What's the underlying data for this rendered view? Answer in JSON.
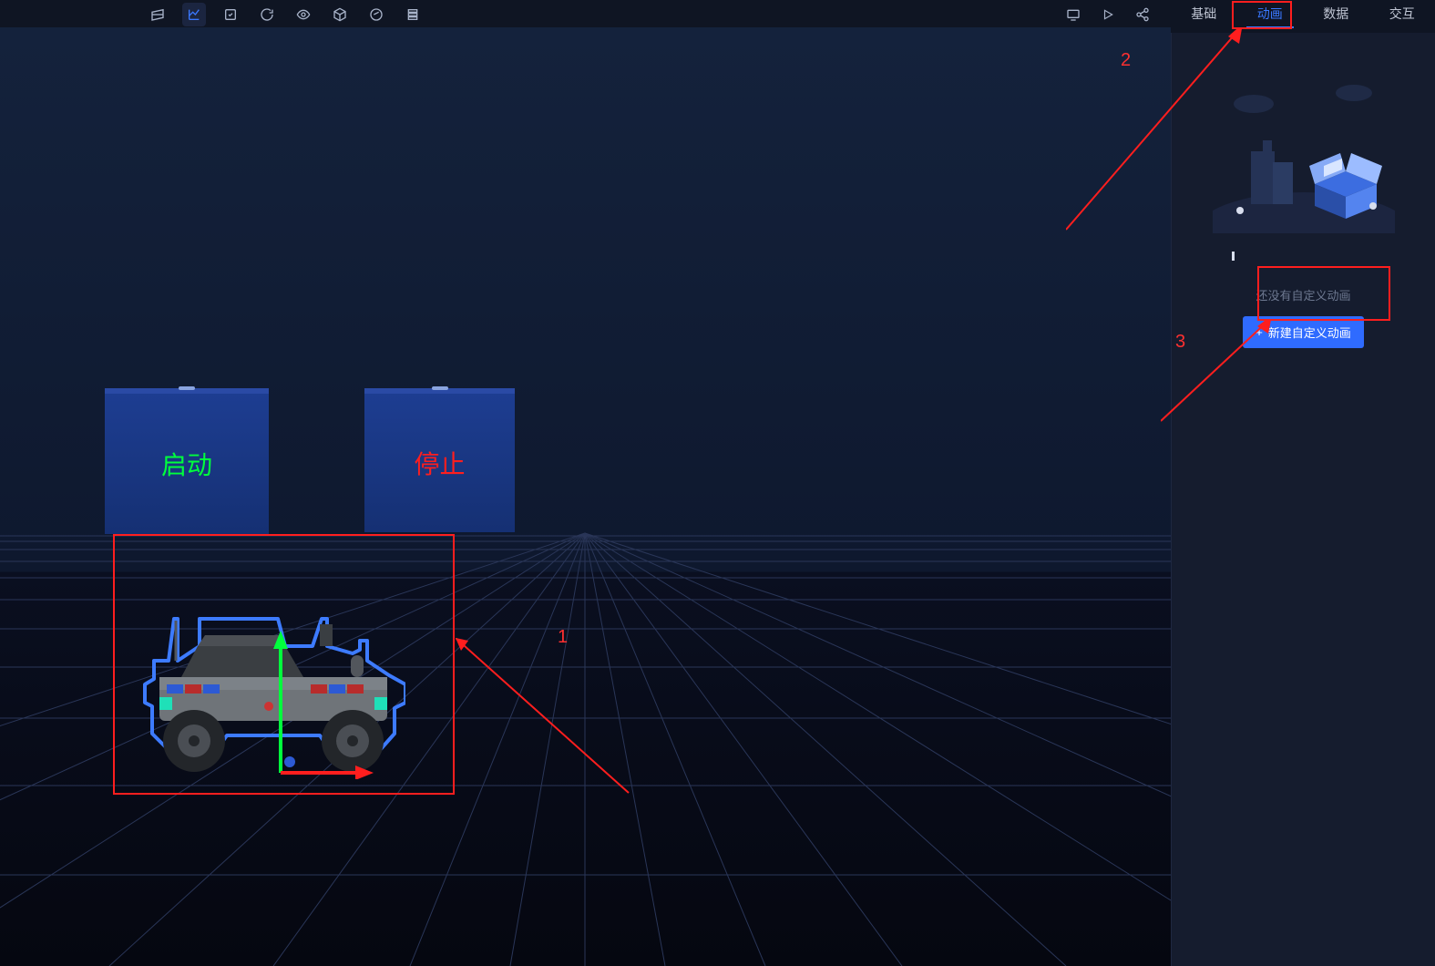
{
  "toolbarLeftIcons": [
    "camera-icon",
    "chart-icon",
    "edit-icon",
    "refresh-icon",
    "eye-icon",
    "cube-icon",
    "circle-icon",
    "list-icon"
  ],
  "toolbarLeftActiveIndex": 1,
  "toolbarRightIcons": [
    "monitor-icon",
    "play-icon",
    "share-icon"
  ],
  "tabs": [
    {
      "label": "基础"
    },
    {
      "label": "动画"
    },
    {
      "label": "数据"
    },
    {
      "label": "交互"
    }
  ],
  "activeTabIndex": 1,
  "sidePanel": {
    "emptyText": "还没有自定义动画",
    "newButtonLabel": "新建自定义动画",
    "newButtonIcon": "+"
  },
  "scene": {
    "startPanelLabel": "启动",
    "stopPanelLabel": "停止"
  },
  "annotations": {
    "label1": "1",
    "label2": "2",
    "label3": "3"
  },
  "colors": {
    "accent": "#3a78ff",
    "annotation": "#ff1e1e",
    "startText": "#00ff3c",
    "stopText": "#ff1e1e",
    "panel": "#1b3a8f"
  }
}
